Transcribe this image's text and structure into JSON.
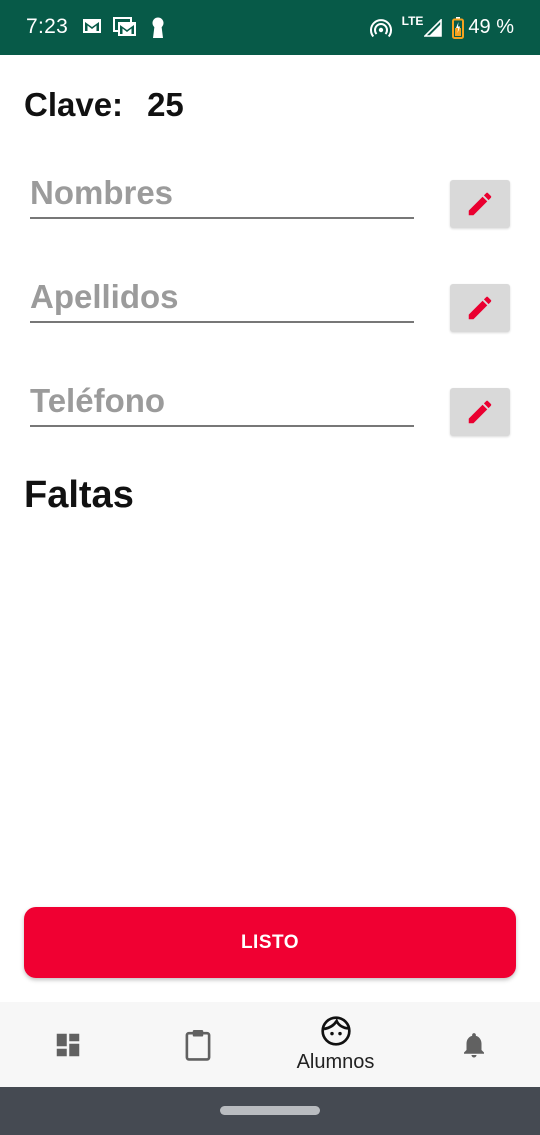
{
  "status_bar": {
    "time": "7:23",
    "network": "LTE",
    "battery": "49 %",
    "icons": [
      "gmail-icon",
      "gmail-icon",
      "keyhole-icon",
      "hotspot-icon",
      "signal-icon",
      "battery-icon"
    ]
  },
  "student": {
    "clave_label": "Clave:",
    "clave_value": "25"
  },
  "fields": {
    "nombres": {
      "value": "",
      "placeholder": "Nombres"
    },
    "apellidos": {
      "value": "",
      "placeholder": "Apellidos"
    },
    "telefono": {
      "value": "",
      "placeholder": "Teléfono"
    }
  },
  "faltas": {
    "title": "Faltas"
  },
  "actions": {
    "listo_label": "LISTO"
  },
  "bottom_nav": {
    "items": [
      {
        "icon": "dashboard-icon",
        "label": ""
      },
      {
        "icon": "clipboard-icon",
        "label": ""
      },
      {
        "icon": "face-icon",
        "label": "Alumnos"
      },
      {
        "icon": "bell-icon",
        "label": ""
      }
    ],
    "active_index": 2
  },
  "colors": {
    "status_bar": "#075a48",
    "accent": "#f00032",
    "edit_button_bg": "#d9d9d9",
    "system_nav": "#454a52"
  }
}
